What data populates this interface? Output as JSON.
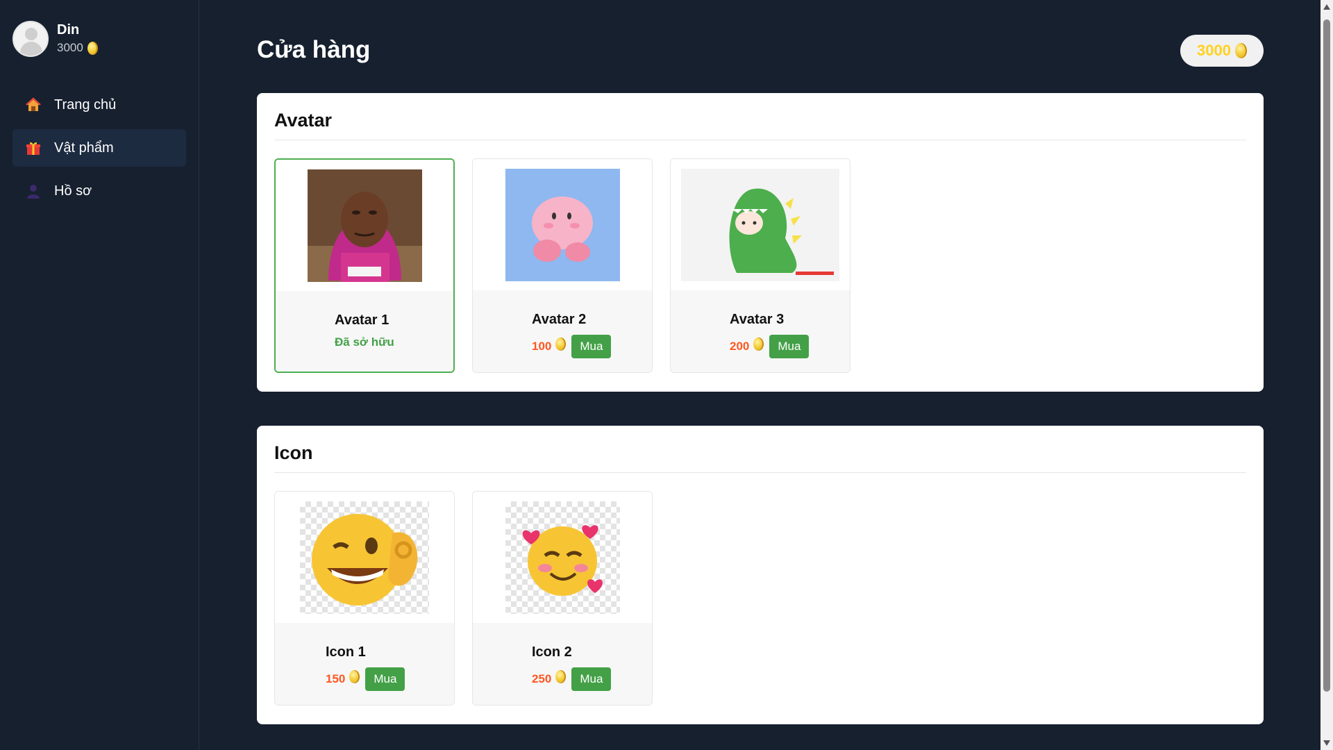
{
  "user": {
    "name": "Din",
    "coins": "3000"
  },
  "nav": [
    {
      "label": "Trang chủ",
      "icon": "home-icon",
      "active": false
    },
    {
      "label": "Vật phẩm",
      "icon": "gift-icon",
      "active": true
    },
    {
      "label": "Hồ sơ",
      "icon": "user-icon",
      "active": false
    }
  ],
  "header": {
    "title": "Cửa hàng",
    "coins": "3000"
  },
  "sections": [
    {
      "title": "Avatar",
      "items": [
        {
          "name": "Avatar 1",
          "status": "Đã sở hữu",
          "owned": true
        },
        {
          "name": "Avatar 2",
          "price": "100",
          "buy_label": "Mua",
          "owned": false
        },
        {
          "name": "Avatar 3",
          "price": "200",
          "buy_label": "Mua",
          "owned": false
        }
      ]
    },
    {
      "title": "Icon",
      "items": [
        {
          "name": "Icon 1",
          "price": "150",
          "buy_label": "Mua",
          "owned": false
        },
        {
          "name": "Icon 2",
          "price": "250",
          "buy_label": "Mua",
          "owned": false
        }
      ]
    }
  ],
  "colors": {
    "accent_green": "#43a047",
    "price_orange": "#ff5722",
    "coin_gold": "#ffd21f",
    "sidebar_bg": "#16202f"
  }
}
